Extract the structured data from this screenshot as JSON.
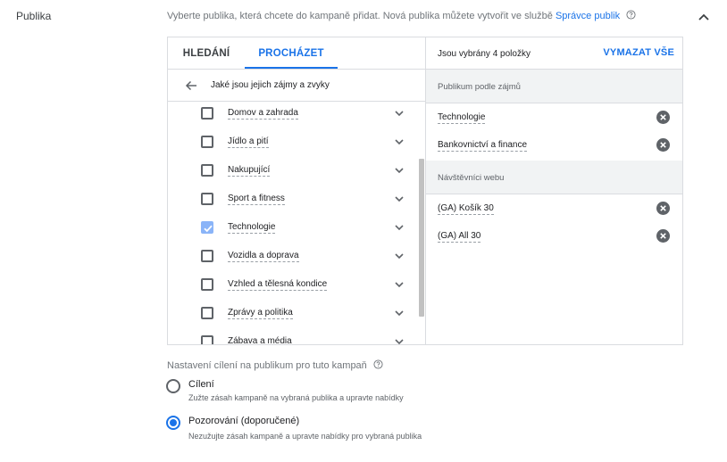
{
  "section": {
    "label": "Publika"
  },
  "description": {
    "text": "Vyberte publika, která chcete do kampaně přidat. Nová publika můžete vytvořit ve službě ",
    "link": "Správce publik"
  },
  "icons": {
    "help": "help-circle-icon",
    "collapse": "chevron-up-icon",
    "back": "arrow-left-icon",
    "expand": "chevron-down-icon",
    "remove": "remove-circle-icon",
    "check": "checkmark-icon"
  },
  "colors": {
    "accent": "#1a73e8",
    "checked": "#8ab4f8",
    "group_bg": "#f1f3f4"
  },
  "browser": {
    "tabs": [
      {
        "label": "HLEDÁNÍ",
        "active": false
      },
      {
        "label": "PROCHÁZET",
        "active": true
      }
    ],
    "back_label": "Jaké jsou jejich zájmy a zvyky",
    "items": [
      {
        "label": "Domov a zahrada",
        "checked": false
      },
      {
        "label": "Jídlo a pití",
        "checked": false
      },
      {
        "label": "Nakupující",
        "checked": false
      },
      {
        "label": "Sport a fitness",
        "checked": false
      },
      {
        "label": "Technologie",
        "checked": true
      },
      {
        "label": "Vozidla a doprava",
        "checked": false
      },
      {
        "label": "Vzhled a tělesná kondice",
        "checked": false
      },
      {
        "label": "Zprávy a politika",
        "checked": false
      },
      {
        "label": "Zábava a média",
        "checked": false
      }
    ]
  },
  "selection": {
    "count_label": "Jsou vybrány 4 položky",
    "clear_label": "VYMAZAT VŠE",
    "groups": [
      {
        "label": "Publikum podle zájmů",
        "items": [
          "Technologie",
          "Bankovnictví a finance"
        ]
      },
      {
        "label": "Návštěvníci webu",
        "items": [
          "(GA) Košík 30",
          "(GA) All 30"
        ]
      }
    ]
  },
  "targeting": {
    "title": "Nastavení cílení na publikum pro tuto kampaň",
    "options": [
      {
        "title": "Cílení",
        "subtitle": "Zužte zásah kampaně na vybraná publika a upravte nabídky",
        "selected": false
      },
      {
        "title": "Pozorování (doporučené)",
        "subtitle": "Nezužujte zásah kampaně a upravte nabídky pro vybraná publika",
        "selected": true
      }
    ]
  }
}
